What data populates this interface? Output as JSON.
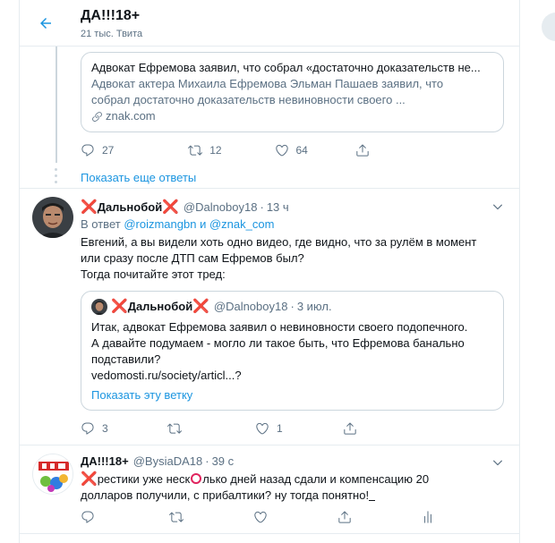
{
  "header": {
    "title": "ДА!!!18+",
    "subtitle": "21 тыс. Твита",
    "back_icon": "arrow-left-icon"
  },
  "link_card": {
    "title": "Адвокат Ефремова заявил, что собрал «достаточно доказательств не...",
    "desc_line1": "Адвокат актера Михаила Ефремова Эльман Пашаев заявил, что",
    "desc_line2": "собрал достаточно доказательств невиновности своего ...",
    "domain": "znak.com"
  },
  "tweet1_actions": {
    "reply": "27",
    "retweet": "12",
    "like": "64"
  },
  "show_more_replies": "Показать еще ответы",
  "tweet2": {
    "x_mark": "❌",
    "name": "Дальнобой",
    "handle": "@Dalnoboy18",
    "dot": "·",
    "time": "13 ч",
    "reply_prefix": "В ответ",
    "reply_user1": "@roizmangbn",
    "reply_and": "и",
    "reply_user2": "@znak_com",
    "text_line1": "Евгений, а вы видели хоть одно видео, где видно, что за рулём в момент",
    "text_line2": "или сразу после ДТП сам Ефремов был?",
    "text_line3": "Тогда почитайте этот тред:",
    "quote": {
      "name": "Дальнобой",
      "handle": "@Dalnoboy18",
      "time": "3 июл.",
      "line1": "Итак, адвокат Ефремова заявил о невиновности своего подопечного.",
      "line2": "А давайте подумаем - могло ли такое быть, что Ефремова банально",
      "line3": "подставили?",
      "line4": "vedomosti.ru/society/articl...?",
      "show_thread": "Показать эту ветку"
    },
    "actions": {
      "reply": "3",
      "like": "1"
    }
  },
  "tweet3": {
    "name": "ДА!!!18+",
    "handle": "@BysiaDA18",
    "dot": "·",
    "time": "39 с",
    "x_mark": "❌",
    "text_a": "рестики уже неск",
    "text_b": "лько дней назад сдали и компенсацию 20",
    "text_line2": "долларов получили, с прибалтики? ну тогда понятно!"
  },
  "colors": {
    "accent": "#1b95e0",
    "secondary_text": "#5b7083",
    "border": "#e6ecf0",
    "red_mark": "#e0245e"
  }
}
